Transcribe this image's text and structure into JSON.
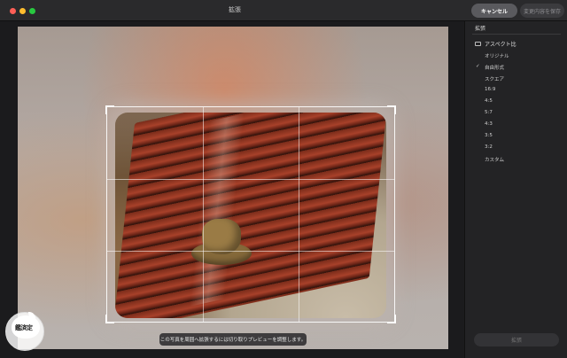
{
  "window": {
    "title": "拡張",
    "cancel_label": "キャンセル",
    "save_label": "変更内容を保存"
  },
  "sidebar": {
    "title": "拡張",
    "section_title": "アスペクト比",
    "selected_option": "自由形式",
    "options": [
      {
        "label": "オリジナル"
      },
      {
        "label": "自由形式"
      },
      {
        "label": "スクエア"
      },
      {
        "label": "16:9"
      },
      {
        "label": "4:5"
      },
      {
        "label": "5:7"
      },
      {
        "label": "4:3"
      },
      {
        "label": "3:5"
      },
      {
        "label": "3:2"
      },
      {
        "label": "カスタム"
      }
    ],
    "apply_label": "拡張"
  },
  "canvas": {
    "hint": "この写真を周囲へ拡張するには切り取りプレビューを調整します。"
  },
  "watermark": {
    "text": "鑑済定"
  },
  "colors": {
    "window_bg": "#1b1b1d",
    "titlebar_bg": "#2a2a2c",
    "sidebar_bg": "#232325",
    "close": "#ff5f57",
    "minimize": "#febc2e",
    "zoom": "#28c840"
  },
  "icons": {
    "aspect": "aspect-ratio-icon",
    "check": "checkmark-icon"
  }
}
